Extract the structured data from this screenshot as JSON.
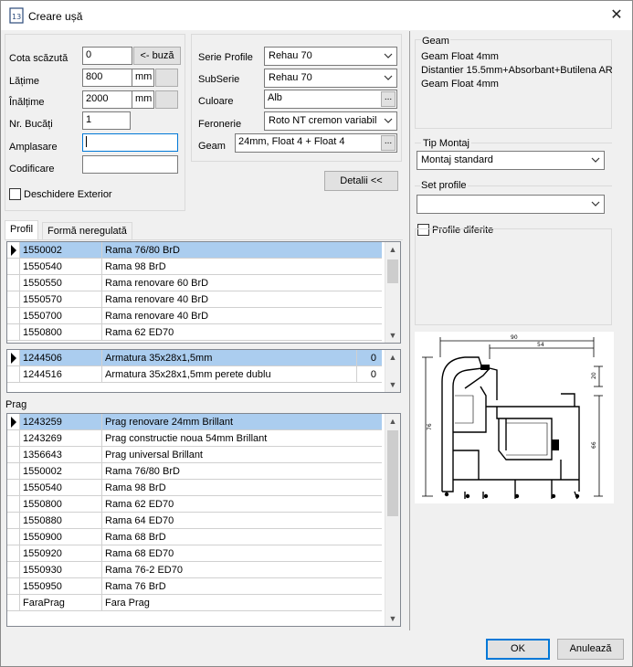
{
  "window": {
    "title": "Creare ușă",
    "close_glyph": "✕"
  },
  "left_form": {
    "cota_label": "Cota scăzută",
    "cota_value": "0",
    "buza_button": "<- buză",
    "latime_label": "Lățime",
    "latime_value": "800",
    "latime_unit": "mm",
    "inaltime_label": "Înălțime",
    "inaltime_value": "2000",
    "inaltime_unit": "mm",
    "bucati_label": "Nr. Bucăți",
    "bucati_value": "1",
    "amplasare_label": "Amplasare",
    "amplasare_value": "",
    "codificare_label": "Codificare",
    "codificare_value": "",
    "deschidere_label": "Deschidere Exterior"
  },
  "mid_form": {
    "serie_label": "Serie Profile",
    "serie_value": "Rehau 70",
    "subserie_label": "SubSerie",
    "subserie_value": "Rehau 70",
    "culoare_label": "Culoare",
    "culoare_value": "Alb",
    "culoare_btn": "...",
    "feronerie_label": "Feronerie",
    "feronerie_value": "Roto NT cremon variabil",
    "geam_label": "Geam",
    "geam_value": "24mm, Float 4 + Float 4",
    "geam_btn": "...",
    "detalii_button": "Detalii <<"
  },
  "tabs": [
    {
      "label": "Profil"
    },
    {
      "label": "Formă neregulată"
    }
  ],
  "profil_grid": {
    "rows": [
      {
        "code": "1550002",
        "name": "Rama 76/80 BrD"
      },
      {
        "code": "1550540",
        "name": "Rama 98 BrD"
      },
      {
        "code": "1550550",
        "name": "Rama renovare 60 BrD"
      },
      {
        "code": "1550570",
        "name": "Rama renovare 40 BrD"
      },
      {
        "code": "1550700",
        "name": "Rama renovare 40 BrD"
      },
      {
        "code": "1550800",
        "name": "Rama 62 ED70"
      }
    ]
  },
  "armatura_grid": {
    "rows": [
      {
        "code": "1244506",
        "name": "Armatura 35x28x1,5mm",
        "qty": "0"
      },
      {
        "code": "1244516",
        "name": "Armatura 35x28x1,5mm perete dublu",
        "qty": "0"
      }
    ]
  },
  "prag": {
    "label": "Prag",
    "rows": [
      {
        "code": "1243259",
        "name": "Prag renovare 24mm Brillant"
      },
      {
        "code": "1243269",
        "name": "Prag constructie noua 54mm Brillant"
      },
      {
        "code": "1356643",
        "name": "Prag universal Brillant"
      },
      {
        "code": "1550002",
        "name": "Rama 76/80 BrD"
      },
      {
        "code": "1550540",
        "name": "Rama 98 BrD"
      },
      {
        "code": "1550800",
        "name": "Rama 62 ED70"
      },
      {
        "code": "1550880",
        "name": "Rama 64 ED70"
      },
      {
        "code": "1550900",
        "name": "Rama 68 BrD"
      },
      {
        "code": "1550920",
        "name": "Rama 68 ED70"
      },
      {
        "code": "1550930",
        "name": "Rama 76-2 ED70"
      },
      {
        "code": "1550950",
        "name": "Rama 76 BrD"
      },
      {
        "code": "FaraPrag",
        "name": "Fara Prag"
      }
    ]
  },
  "right_panel": {
    "geam_title": "Geam",
    "geam_lines": [
      "Geam Float 4mm",
      "Distantier 15.5mm+Absorbant+Butilena AR",
      "Geam Float 4mm"
    ],
    "montaj_label": "Tip Montaj",
    "montaj_value": "Montaj standard",
    "setprofile_label": "Set profile",
    "setprofile_value": "",
    "profile_diferite_label": "Profile diferite",
    "dims": {
      "d90": "90",
      "d54": "54",
      "d20": "20",
      "d76": "76",
      "d66": "66"
    }
  },
  "footer": {
    "ok": "OK",
    "cancel": "Anulează"
  }
}
